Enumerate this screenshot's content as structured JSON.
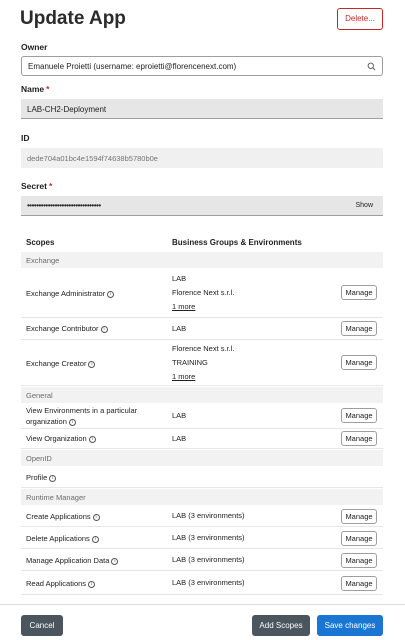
{
  "header": {
    "title": "Update App",
    "delete_label": "Delete..."
  },
  "owner": {
    "label": "Owner",
    "value": "Emanuele Proietti (username: eproietti@florencenext.com)"
  },
  "name": {
    "label": "Name",
    "required": "*",
    "value": "LAB-CH2-Deployment"
  },
  "id": {
    "label": "ID",
    "value": "dede704a01bc4e1594f74638b5780b0e"
  },
  "secret": {
    "label": "Secret",
    "required": "*",
    "value": "••••••••••••••••••••••••••••••••",
    "show_label": "Show"
  },
  "scopes_table": {
    "col_scopes": "Scopes",
    "col_groups": "Business Groups & Environments",
    "manage_label": "Manage",
    "sections": {
      "exchange": "Exchange",
      "general": "General",
      "openid": "OpenID",
      "runtime": "Runtime Manager"
    },
    "rows": {
      "exchange_admin": {
        "name": "Exchange Administrator",
        "g1": "LAB",
        "g2": "Florence Next s.r.l.",
        "more": "1 more"
      },
      "exchange_contrib": {
        "name": "Exchange Contributor",
        "g1": "LAB"
      },
      "exchange_creator": {
        "name": "Exchange Creator",
        "g1": "Florence Next s.r.l.",
        "g2": "TRAINING",
        "more": "1 more"
      },
      "view_envs": {
        "name_line1": "View Environments in a particular",
        "name_line2": "organization",
        "g1": "LAB"
      },
      "view_org": {
        "name": "View Organization",
        "g1": "LAB"
      },
      "profile": {
        "name": "Profile"
      },
      "create_apps": {
        "name": "Create Applications",
        "g1": "LAB  (3 environments)"
      },
      "delete_apps": {
        "name": "Delete Applications",
        "g1": "LAB  (3 environments)"
      },
      "manage_data": {
        "name": "Manage Application Data",
        "g1": "LAB  (3 environments)"
      },
      "read_apps": {
        "name": "Read Applications",
        "g1": "LAB  (3 environments)"
      }
    }
  },
  "footer": {
    "cancel_label": "Cancel",
    "add_scopes_label": "Add Scopes",
    "save_label": "Save changes"
  }
}
